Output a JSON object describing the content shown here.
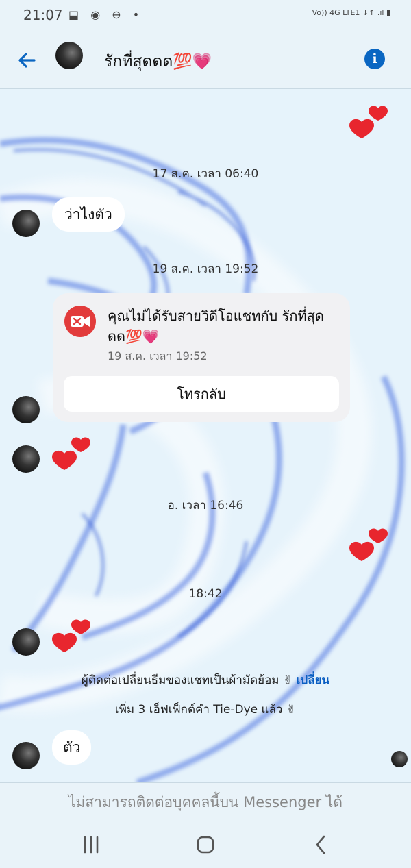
{
  "status_bar": {
    "time": "21:07",
    "icons": "⬓ ◉ ⊖ •",
    "network": "Vo)) 4G LTE1 ↓↑ .ıl ▮"
  },
  "header": {
    "contact_name": "รักที่สุดดด💯💗",
    "back_icon": "arrow-left-icon",
    "info_icon": "info-icon",
    "info_glyph": "i",
    "accent_color": "#0a66c2"
  },
  "messages": {
    "ts1": "17 ส.ค. เวลา 06:40",
    "msg1": "ว่าไงตัว",
    "ts2": "19 ส.ค. เวลา 19:52",
    "missed_call": {
      "text": "คุณไม่ได้รับสายวิดีโอแชทกับ รักที่สุดดด💯💗",
      "time": "19 ส.ค. เวลา 19:52",
      "button": "โทรกลับ",
      "icon": "video-missed-icon",
      "icon_color": "#e23b3b"
    },
    "ts3": "อ. เวลา 16:46",
    "ts4": "18:42",
    "notice1": "ผู้ติดต่อเปลี่ยนธีมของแชทเป็นผ้ามัดย้อม ✌",
    "notice1_link": "เปลี่ยน",
    "notice2": "เพิ่ม 3 เอ็ฟเฟ็กต์คำ Tie-Dye แล้ว ✌",
    "msg2": "ตัว"
  },
  "footer": {
    "unavailable": "ไม่สามารถติดต่อบุคคลนี้บน Messenger ได้"
  },
  "nav": {
    "recents_icon": "recents-icon",
    "home_icon": "home-icon",
    "back_icon": "nav-back-icon"
  }
}
